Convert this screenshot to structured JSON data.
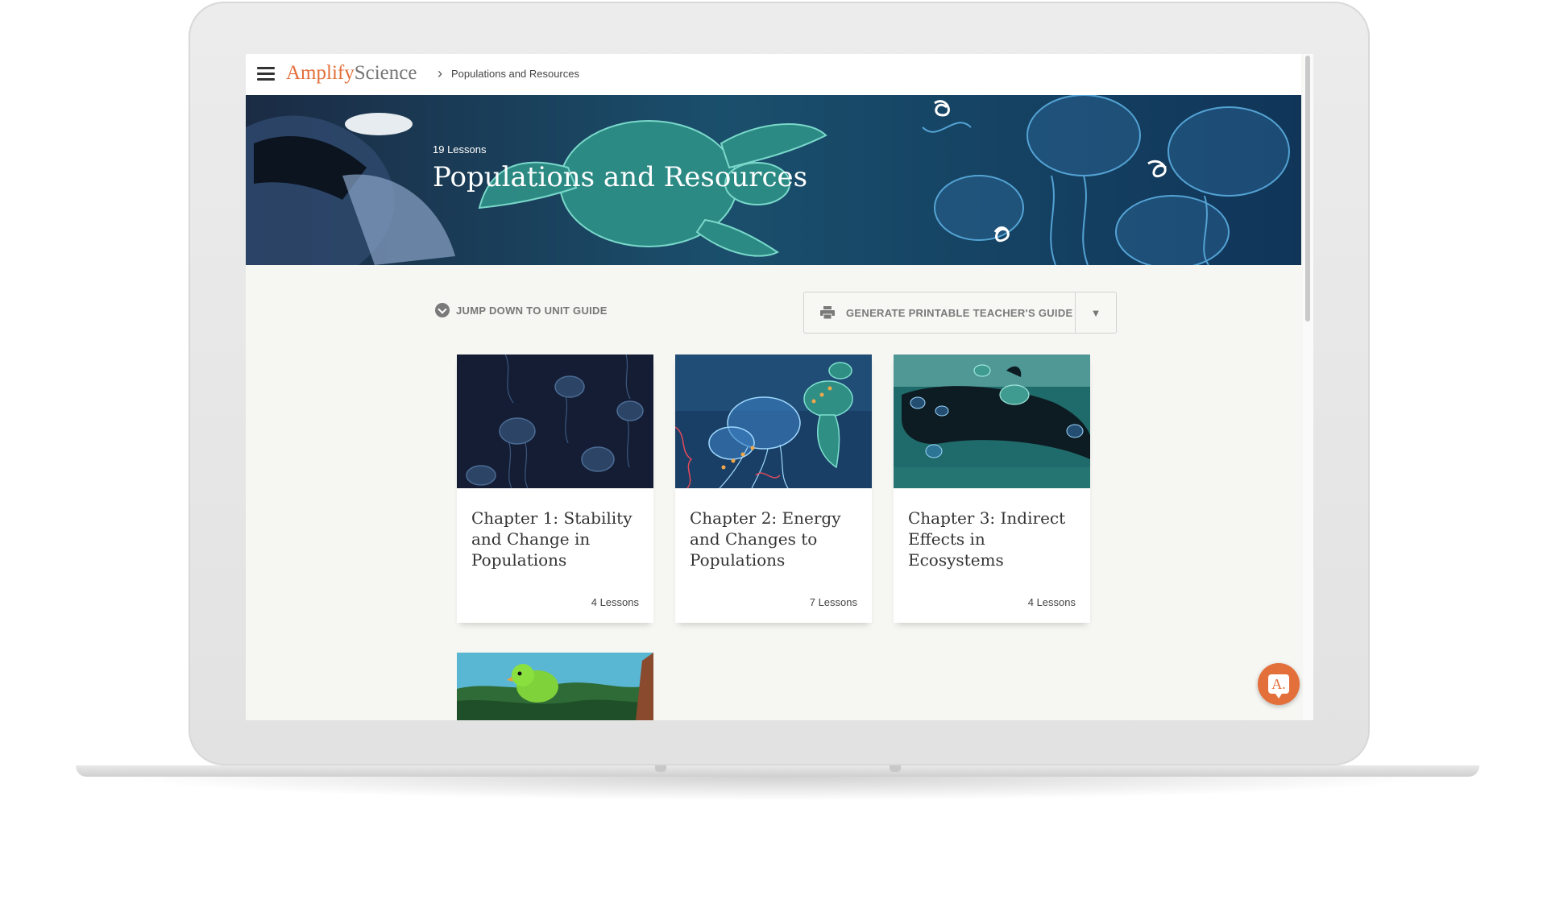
{
  "app": {
    "logo_primary": "Amplify",
    "logo_secondary": "Science",
    "breadcrumb": "Populations and Resources"
  },
  "hero": {
    "lessons": "19 Lessons",
    "title": "Populations and Resources"
  },
  "actions": {
    "jump": "JUMP DOWN TO UNIT GUIDE",
    "generate": "GENERATE PRINTABLE TEACHER'S GUIDE"
  },
  "chapters": [
    {
      "title": "Chapter 1: Stability and Change in Populations",
      "lessons": "4 Lessons"
    },
    {
      "title": "Chapter 2: Energy and Changes to Populations",
      "lessons": "7 Lessons"
    },
    {
      "title": "Chapter 3: Indirect Effects in Ecosystems",
      "lessons": "4 Lessons"
    }
  ],
  "help": {
    "label": "A."
  },
  "colors": {
    "accent": "#e36f3a",
    "hero_bg": "#123a5c",
    "page_bg": "#f6f6f2"
  }
}
